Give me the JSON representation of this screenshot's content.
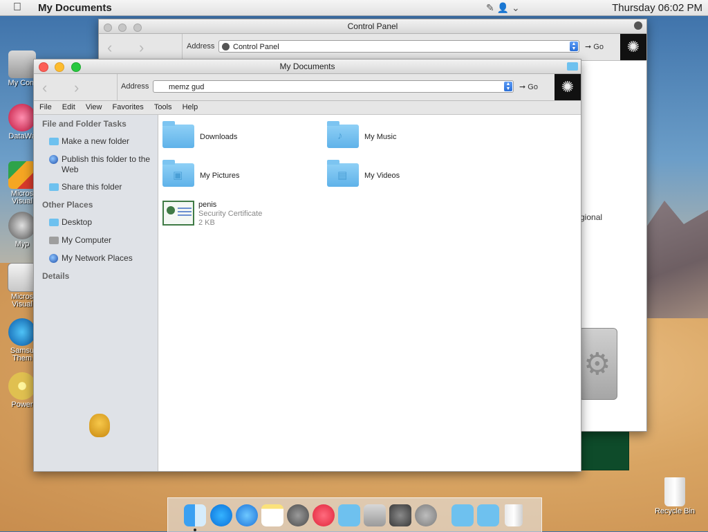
{
  "menubar": {
    "app_title": "My Documents",
    "clock": "Thursday 06:02 PM"
  },
  "desktop_icons": [
    {
      "label": "My Com"
    },
    {
      "label": "DataWa"
    },
    {
      "label": "Micros Visual"
    },
    {
      "label": "Myp"
    },
    {
      "label": "Micros Visual"
    },
    {
      "label": "Samsu Them"
    },
    {
      "label": "Power"
    },
    {
      "label": "Recycle Bin"
    }
  ],
  "control_panel": {
    "title": "Control Panel",
    "address_label": "Address",
    "address_value": "Control Panel",
    "go_label": "Go",
    "partial_text": "gional"
  },
  "my_documents": {
    "title": "My Documents",
    "address_label": "Address",
    "address_value": "memz gud",
    "go_label": "Go",
    "menus": [
      "File",
      "Edit",
      "View",
      "Favorites",
      "Tools",
      "Help"
    ],
    "sidebar": {
      "file_tasks_title": "File and Folder Tasks",
      "file_tasks": [
        {
          "label": "Make a new folder",
          "icon": "folder-icon"
        },
        {
          "label": "Publish this folder to the Web",
          "icon": "globe-icon"
        },
        {
          "label": "Share this folder",
          "icon": "share-folder-icon"
        }
      ],
      "other_places_title": "Other Places",
      "other_places": [
        {
          "label": "Desktop",
          "icon": "desktop-icon"
        },
        {
          "label": "My Computer",
          "icon": "computer-icon"
        },
        {
          "label": "My Network Places",
          "icon": "network-icon"
        }
      ],
      "details_title": "Details"
    },
    "items": [
      {
        "name": "Downloads",
        "icon": "downloads-folder-icon"
      },
      {
        "name": "My Music",
        "icon": "music-folder-icon"
      },
      {
        "name": "My Pictures",
        "icon": "pictures-folder-icon"
      },
      {
        "name": "My Videos",
        "icon": "videos-folder-icon"
      },
      {
        "name": "penis",
        "type": "Security Certificate",
        "size": "2 KB",
        "icon": "certificate-icon"
      }
    ]
  },
  "colors": {
    "folder": "#6ec1ef",
    "sidebar_bg": "#dfe2e7",
    "close": "#fc5f57",
    "minimize": "#fdbc2e",
    "zoom": "#28c840"
  }
}
